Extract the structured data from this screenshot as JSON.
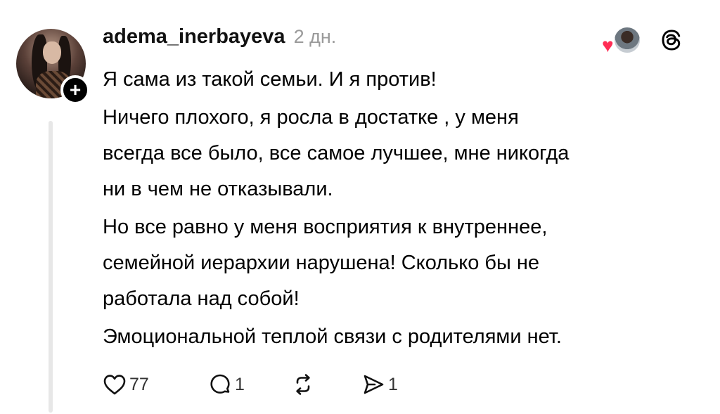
{
  "post": {
    "username": "adema_inerbayeva",
    "time": "2 дн.",
    "follow_symbol": "+",
    "paragraphs": [
      [
        "Я сама из такой семьи. И я против!"
      ],
      [
        "Ничего плохого, я росла в достатке , у меня",
        "всегда все было, все самое лучшее, мне никогда",
        "ни в чем не отказывали."
      ],
      [
        "Но все равно у меня восприятия к внутреннее,",
        "семейной иерархии нарушена! Сколько бы не",
        "работала над собой!"
      ],
      [
        "Эмоциональной теплой связи с родителями нет."
      ]
    ]
  },
  "actions": {
    "likes": "77",
    "replies": "1",
    "shares": "1"
  },
  "icons": {
    "like": "heart-outline-icon",
    "reply": "comment-bubble-icon",
    "repost": "repost-arrows-icon",
    "share": "send-icon",
    "liked_by": "heart-icon",
    "brand": "threads-logo-icon"
  },
  "colors": {
    "heart": "#ff2d55",
    "muted": "#9a9a9a",
    "thread_line": "#e7e7e7",
    "text": "#000000"
  }
}
